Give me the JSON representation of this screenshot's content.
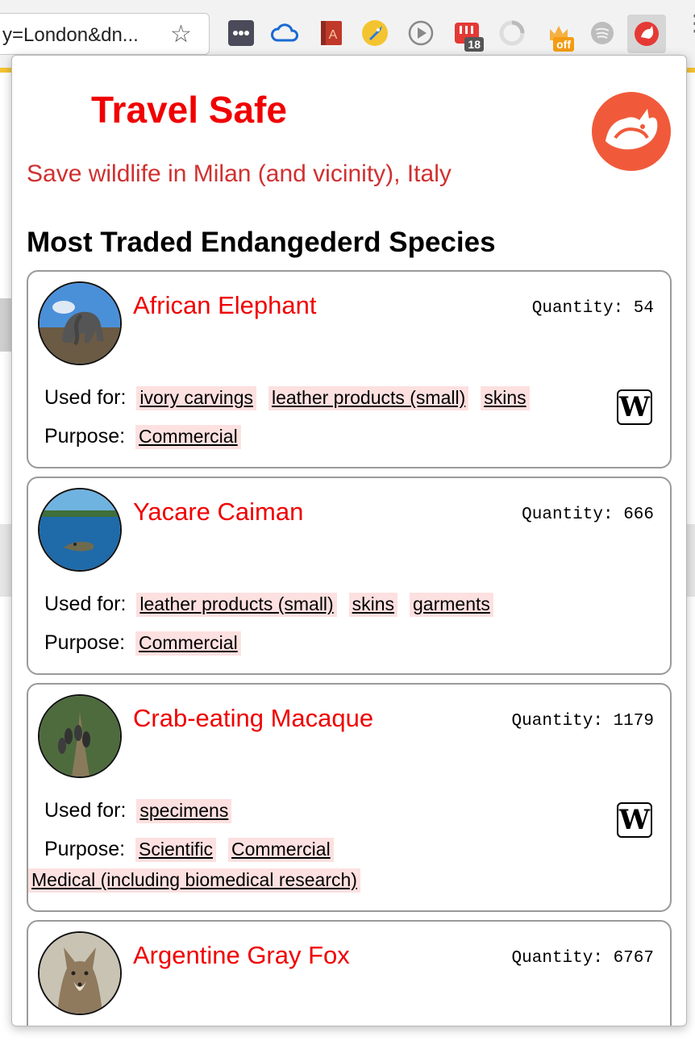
{
  "browser": {
    "url_text": "y=London&dn...",
    "extension_badges": {
      "calendar": "18",
      "power": "off"
    }
  },
  "popup": {
    "title": "Travel Safe",
    "subtitle": "Save wildlife in Milan (and vicinity), Italy",
    "section_heading": "Most Traded Endangederd Species",
    "quantity_label": "Quantity:",
    "used_for_label": "Used for:",
    "purpose_label": "Purpose:",
    "wiki_glyph": "W",
    "species": [
      {
        "name": "African Elephant",
        "quantity": "54",
        "used_for": [
          "ivory carvings",
          "leather products (small)",
          "skins"
        ],
        "purpose": [
          "Commercial"
        ]
      },
      {
        "name": "Yacare Caiman",
        "quantity": "666",
        "used_for": [
          "leather products (small)",
          "skins",
          "garments"
        ],
        "purpose": [
          "Commercial"
        ]
      },
      {
        "name": "Crab-eating Macaque",
        "quantity": "1179",
        "used_for": [
          "specimens"
        ],
        "purpose": [
          "Scientific",
          "Commercial",
          "Medical (including biomedical research)"
        ]
      },
      {
        "name": "Argentine Gray Fox",
        "quantity": "6767"
      }
    ]
  },
  "colors": {
    "accent_red": "#f00000",
    "subtitle_red": "#d03030",
    "tag_bg": "#fde0e0",
    "logo": "#f05a3a"
  }
}
